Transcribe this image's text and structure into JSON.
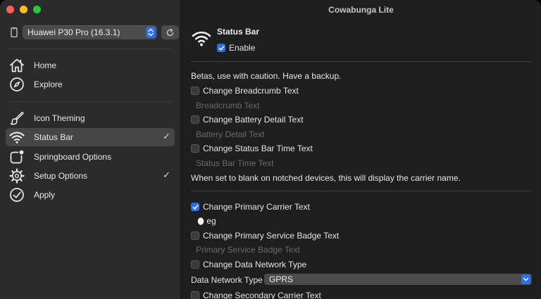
{
  "window": {
    "title": "Cowabunga Lite"
  },
  "device": {
    "selected": "Huawei P30 Pro (16.3.1)"
  },
  "sidebar": {
    "items": [
      {
        "label": "Home",
        "icon": "house-icon",
        "checked": false
      },
      {
        "label": "Explore",
        "icon": "compass-icon",
        "checked": false
      },
      {
        "label": "Icon Theming",
        "icon": "paintbrush-icon",
        "checked": false
      },
      {
        "label": "Status Bar",
        "icon": "wifi-icon",
        "checked": true,
        "selected": true
      },
      {
        "label": "Springboard Options",
        "icon": "app-badge-icon",
        "checked": false
      },
      {
        "label": "Setup Options",
        "icon": "gear-icon",
        "checked": true
      },
      {
        "label": "Apply",
        "icon": "checkmark-circle-icon",
        "checked": false
      }
    ],
    "check_mark": "✓"
  },
  "main": {
    "header": {
      "title": "Status Bar",
      "enable_label": "Enable",
      "enable_checked": true
    },
    "beta_warning": "Betas, use with caution. Have a backup.",
    "options": {
      "breadcrumb": {
        "label": "Change Breadcrumb Text",
        "checked": false,
        "placeholder": "Breadcrumb Text"
      },
      "battery": {
        "label": "Change Battery Detail Text",
        "checked": false,
        "placeholder": "Battery Detail Text"
      },
      "time": {
        "label": "Change Status Bar Time Text",
        "checked": false,
        "placeholder": "Status Bar Time Text"
      },
      "time_note": "When set to blank on notched devices, this will display the carrier name.",
      "carrier": {
        "label": "Change Primary Carrier Text",
        "checked": true,
        "value": "eg"
      },
      "service_badge": {
        "label": "Change Primary Service Badge Text",
        "checked": false,
        "placeholder": "Primary Service Badge Text"
      },
      "data_network": {
        "label": "Change Data Network Type",
        "checked": false
      },
      "data_network_type": {
        "label": "Data Network Type",
        "value": "GPRS"
      },
      "secondary_carrier": {
        "label": "Change Secondary Carrier Text",
        "checked": false
      }
    }
  },
  "colors": {
    "accent": "#2e6fe6",
    "close": "#fe5f57",
    "minimize": "#febc2e",
    "maximize": "#28c840"
  }
}
